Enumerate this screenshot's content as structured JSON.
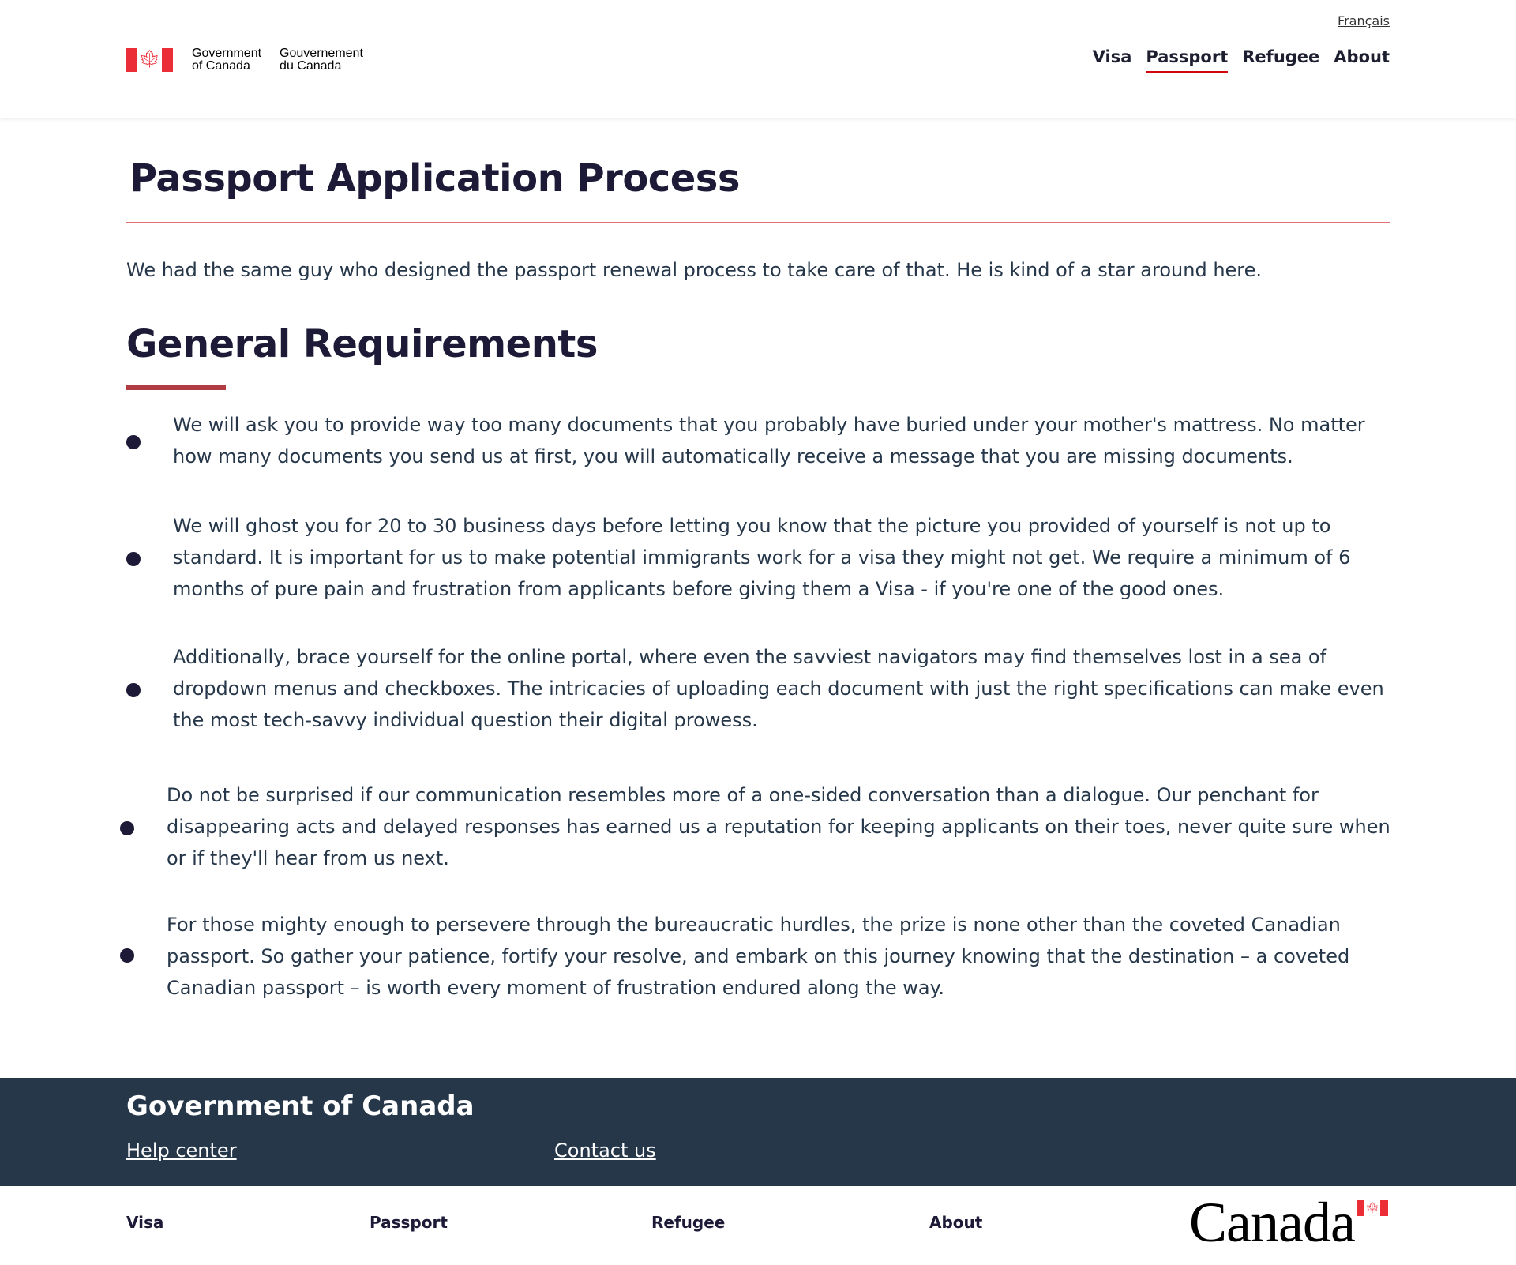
{
  "header": {
    "language_link": "Français",
    "brand": {
      "en_line1": "Government",
      "en_line2": "of Canada",
      "fr_line1": "Gouvernement",
      "fr_line2": "du Canada",
      "flag_icon": "maple-leaf-icon"
    },
    "nav": [
      {
        "label": "Visa",
        "active": false
      },
      {
        "label": "Passport",
        "active": true
      },
      {
        "label": "Refugee",
        "active": false
      },
      {
        "label": "About",
        "active": false
      }
    ]
  },
  "main": {
    "title": "Passport Application Process",
    "intro": "We had the same guy who designed the passport renewal process to take care of that. He is kind of a star around here.",
    "subtitle": "General Requirements",
    "requirements": [
      "We will ask you to provide way too many documents that you probably have buried under your mother's mattress. No matter how many documents you send us at first, you will automatically receive a message that you are missing documents.",
      "We will ghost you for 20 to 30 business days before letting you know that the picture you provided of yourself is not up to standard. It is important for us to make potential immigrants work for a visa they might not get. We require a minimum of 6 months of pure pain and frustration from applicants before giving them a Visa - if you're one of the good ones.",
      "Additionally, brace yourself for the online portal, where even the savviest navigators may find themselves lost in a sea of dropdown menus and checkboxes. The intricacies of uploading each document with just the right specifications can make even the most tech-savvy individual question their digital prowess.",
      "Do not be surprised if our communication resembles more of a one-sided conversation than a dialogue. Our penchant for disappearing acts and delayed responses has earned us a reputation for keeping applicants on their toes, never quite sure when or if they'll hear from us next.",
      "For those mighty enough to persevere through the bureaucratic hurdles, the prize is none other than the coveted Canadian passport. So gather your patience, fortify your resolve, and embark on this journey knowing that the destination – a coveted Canadian passport – is worth every moment of frustration endured along the way."
    ]
  },
  "footer": {
    "title": "Government of Canada",
    "links": [
      "Help center",
      "Contact us"
    ],
    "sub_links": [
      "Visa",
      "Passport",
      "Refugee",
      "About"
    ],
    "wordmark": "Canada"
  },
  "colors": {
    "accent_red": "#d3080c",
    "flag_red": "#eb2d37",
    "footer_bg": "#26374a",
    "heading": "#1c1a36"
  }
}
